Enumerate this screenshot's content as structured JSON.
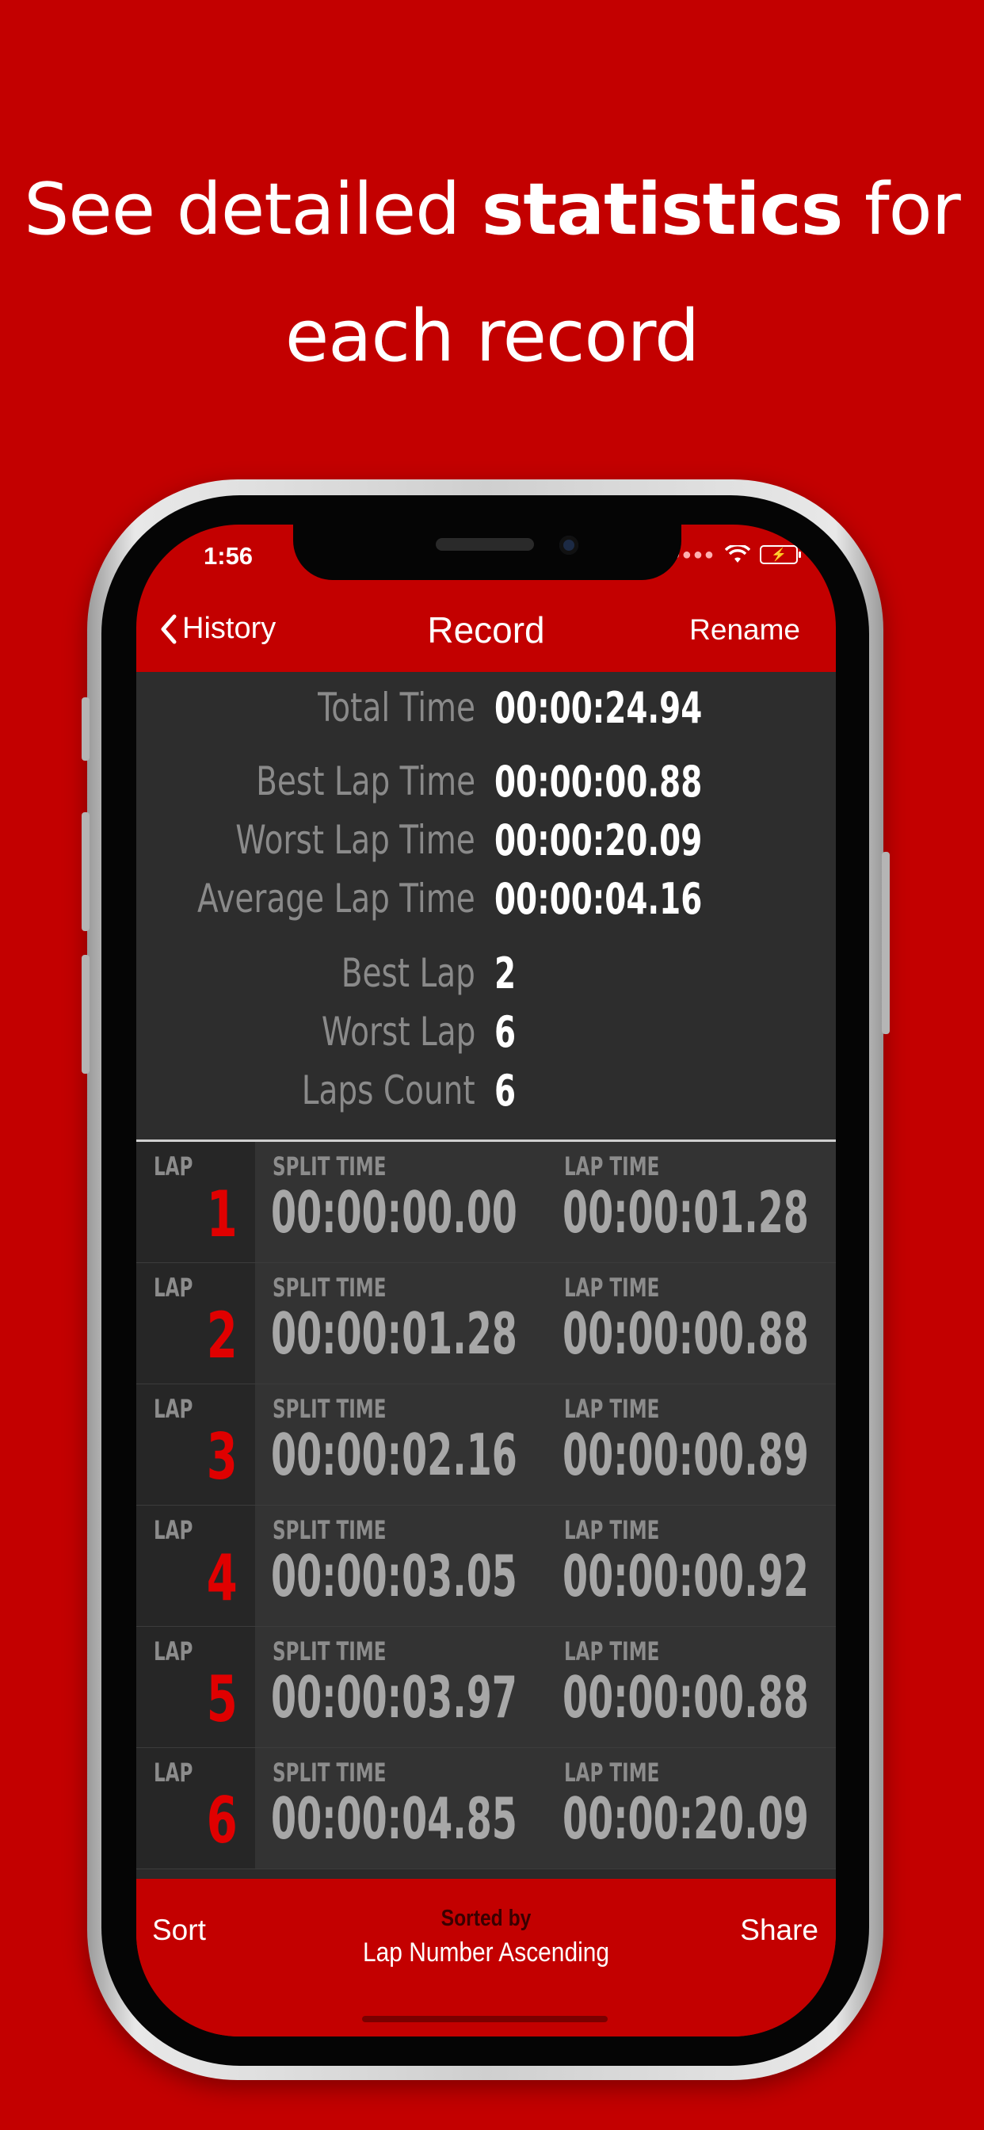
{
  "headline": {
    "pre": "See detailed ",
    "bold": "statistics",
    "post": " for",
    "line2": "each record"
  },
  "status": {
    "time": "1:56"
  },
  "nav": {
    "back": "History",
    "title": "Record",
    "rename": "Rename"
  },
  "stats": [
    {
      "label": "Total Time",
      "value": "00:00:24.94"
    },
    {
      "label": "Best Lap Time",
      "value": "00:00:00.88"
    },
    {
      "label": "Worst Lap Time",
      "value": "00:00:20.09"
    },
    {
      "label": "Average Lap Time",
      "value": "00:00:04.16"
    },
    {
      "label": "Best Lap",
      "value": "2"
    },
    {
      "label": "Worst Lap",
      "value": "6"
    },
    {
      "label": "Laps Count",
      "value": "6"
    }
  ],
  "lap_labels": {
    "lap": "LAP",
    "split": "SPLIT TIME",
    "lap_time": "LAP TIME"
  },
  "laps": [
    {
      "number": "1",
      "split": "00:00:00.00",
      "lap_time": "00:00:01.28"
    },
    {
      "number": "2",
      "split": "00:00:01.28",
      "lap_time": "00:00:00.88"
    },
    {
      "number": "3",
      "split": "00:00:02.16",
      "lap_time": "00:00:00.89"
    },
    {
      "number": "4",
      "split": "00:00:03.05",
      "lap_time": "00:00:00.92"
    },
    {
      "number": "5",
      "split": "00:00:03.97",
      "lap_time": "00:00:00.88"
    },
    {
      "number": "6",
      "split": "00:00:04.85",
      "lap_time": "00:00:20.09"
    }
  ],
  "footer": {
    "sort": "Sort",
    "sorted_by": "Sorted by",
    "sort_mode": "Lap Number Ascending",
    "share": "Share"
  },
  "colors": {
    "brand_red": "#c30000",
    "lap_number_red": "#e00000",
    "panel_dark": "#2d2d2d"
  }
}
